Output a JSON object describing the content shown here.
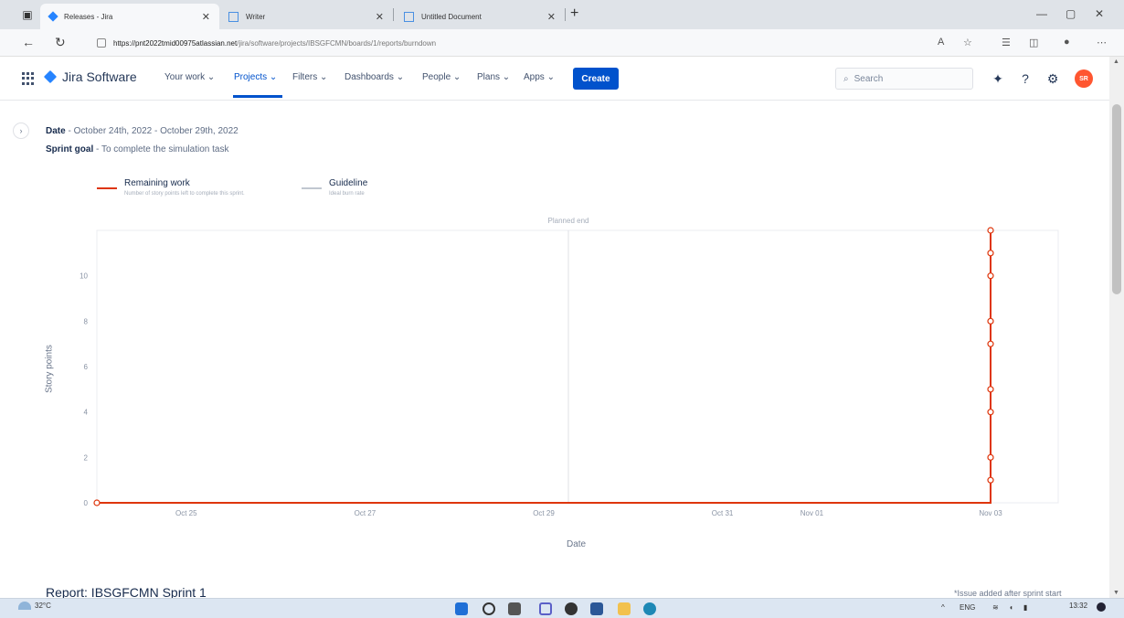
{
  "browser": {
    "tabs": [
      {
        "title": "Releases - Jira",
        "active": true
      },
      {
        "title": "Writer",
        "active": false
      },
      {
        "title": "Untitled Document",
        "active": false
      }
    ],
    "url_host": "https://pnt2022tmid00975atlassian.net",
    "url_path": "/jira/software/projects/IBSGFCMN/boards/1/reports/burndown"
  },
  "jira_nav": {
    "product": "Jira Software",
    "items": [
      {
        "label": "Your work ⌄"
      },
      {
        "label": "Projects ⌄"
      },
      {
        "label": "Filters ⌄"
      },
      {
        "label": "Dashboards ⌄"
      },
      {
        "label": "People ⌄"
      },
      {
        "label": "Plans ⌄"
      },
      {
        "label": "Apps ⌄"
      }
    ],
    "create_label": "Create",
    "search_placeholder": "Search",
    "avatar_initials": "SR"
  },
  "report": {
    "date_label": "Date",
    "date_value": " - October 24th, 2022 - October 29th, 2022",
    "goal_label": "Sprint goal",
    "goal_value": " - To complete the simulation task",
    "legend": [
      {
        "title": "Remaining work",
        "desc": "Number of story points left to complete this sprint.",
        "color": "#de350b"
      },
      {
        "title": "Guideline",
        "desc": "Ideal burn rate",
        "color": "#c1c7d0"
      }
    ],
    "planned_end_label": "Planned end",
    "title": "Report: IBSGFCMN Sprint 1",
    "note": "*Issue added after sprint start"
  },
  "chart_data": {
    "type": "line",
    "xlabel": "Date",
    "ylabel": "Story points",
    "x_ticks": [
      "Oct 25",
      "Oct 27",
      "Oct 29",
      "Oct 31",
      "Nov 01",
      "Nov 03"
    ],
    "y_ticks": [
      0,
      2,
      4,
      6,
      8,
      10
    ],
    "ylim": [
      0,
      12
    ],
    "grid": false,
    "series": [
      {
        "name": "Remaining work",
        "color": "#de350b",
        "points": [
          {
            "x": "Oct 24",
            "y": 0
          },
          {
            "x": "Nov 03",
            "y": 0
          },
          {
            "x": "Nov 03",
            "y": 1
          },
          {
            "x": "Nov 03",
            "y": 2
          },
          {
            "x": "Nov 03",
            "y": 4
          },
          {
            "x": "Nov 03",
            "y": 5
          },
          {
            "x": "Nov 03",
            "y": 7
          },
          {
            "x": "Nov 03",
            "y": 8
          },
          {
            "x": "Nov 03",
            "y": 10
          },
          {
            "x": "Nov 03",
            "y": 11
          },
          {
            "x": "Nov 03",
            "y": 12
          }
        ]
      },
      {
        "name": "Guideline",
        "color": "#c1c7d0",
        "points": []
      }
    ],
    "planned_end": "Oct 29"
  },
  "taskbar": {
    "temperature": "32°C",
    "lang": "ENG",
    "time": "13:32"
  }
}
